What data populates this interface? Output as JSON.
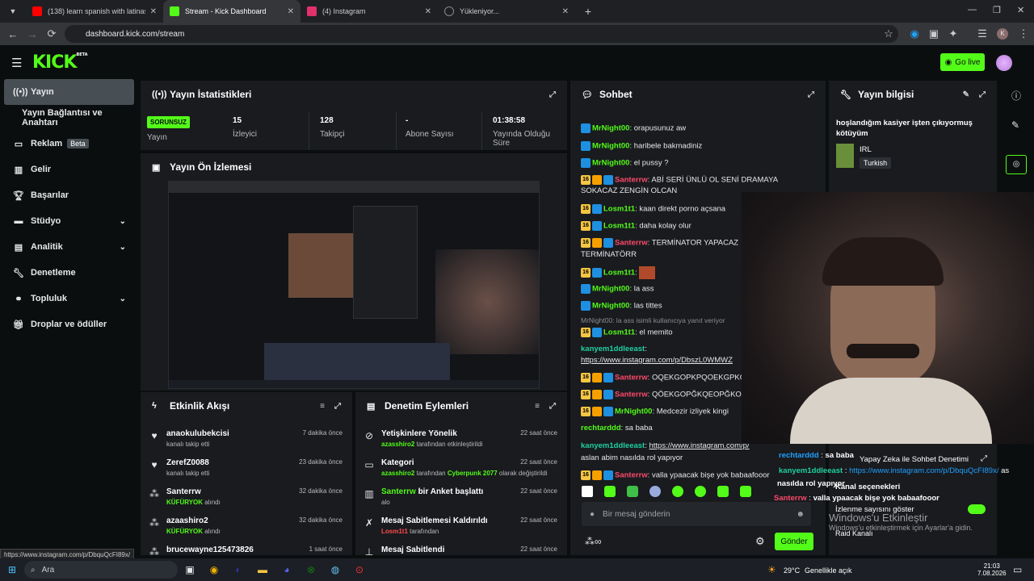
{
  "browser": {
    "tabs": [
      {
        "title": "(138) learn spanish with latinas",
        "color": "#ff0000"
      },
      {
        "title": "Stream - Kick Dashboard",
        "color": "#53fc18"
      },
      {
        "title": "(4) Instagram",
        "color": "#e1306c"
      },
      {
        "title": "Yükleniyor...",
        "color": "#555"
      }
    ],
    "url": "dashboard.kick.com/stream",
    "status_url": "https://www.instagram.com/p/DbquQcFI89x/"
  },
  "header": {
    "logo": "KICK",
    "logo_sup": "BETA",
    "go_live": "Go live"
  },
  "sidebar": {
    "items": [
      {
        "label": "Yayın",
        "icon": "broadcast-icon"
      },
      {
        "label": "Yayın Bağlantısı ve Anahtarı",
        "icon": ""
      },
      {
        "label": "Reklam",
        "icon": "ad-icon",
        "badge": "Beta"
      },
      {
        "label": "Gelir",
        "icon": "chart-icon"
      },
      {
        "label": "Başarılar",
        "icon": "trophy-icon"
      },
      {
        "label": "Stüdyo",
        "icon": "studio-icon"
      },
      {
        "label": "Analitik",
        "icon": "analytics-icon"
      },
      {
        "label": "Denetleme",
        "icon": "wrench-icon"
      },
      {
        "label": "Topluluk",
        "icon": "community-icon"
      },
      {
        "label": "Droplar ve ödüller",
        "icon": "gift-icon"
      }
    ]
  },
  "stats": {
    "title": "Yayın İstatistikleri",
    "status": "SORUNSUZ",
    "status_label": "Yayın",
    "viewers": "15",
    "viewers_label": "İzleyici",
    "followers": "128",
    "followers_label": "Takipçi",
    "subs": "-",
    "subs_label": "Abone Sayısı",
    "uptime": "01:38:58",
    "uptime_label": "Yayında Olduğu Süre"
  },
  "preview": {
    "title": "Yayın Ön İzlemesi"
  },
  "activity": {
    "title": "Etkinlik Akışı",
    "rows": [
      {
        "name": "anaokulubekcisi",
        "sub": "kanalı takip etti",
        "time": "7 dakika önce"
      },
      {
        "name": "ZerefZ0088",
        "sub": "kanalı takip etti",
        "time": "23 dakika önce"
      },
      {
        "name": "Santerrw",
        "sub_hl": "KÜFÜRYOK",
        "sub": "alındı",
        "time": "32 dakika önce"
      },
      {
        "name": "azaashiro2",
        "sub_hl": "KÜFÜRYOK",
        "sub": "alındı",
        "time": "32 dakika önce"
      },
      {
        "name": "brucewayne125473826",
        "sub": "",
        "time": "1 saat önce"
      }
    ]
  },
  "moderation": {
    "title": "Denetim Eylemleri",
    "rows": [
      {
        "name": "Yetişkinlere Yönelik",
        "user": "azasshiro2",
        "sub": "tarafından etkinleştirildi",
        "time": "22 saat önce"
      },
      {
        "name": "Kategori",
        "user": "azasshiro2",
        "sub": "tarafından",
        "extra": "Cyberpunk 2077",
        "sub2": "olarak değiştirildi",
        "time": "22 saat önce"
      },
      {
        "name": "bir Anket başlattı",
        "user_head": "Santerrw",
        "sub": "alo",
        "time": "22 saat önce"
      },
      {
        "name": "Mesaj Sabitlemesi Kaldırıldı",
        "user": "Losm1t1",
        "sub": "tarafından",
        "time": "22 saat önce"
      },
      {
        "name": "Mesaj Sabitlendi",
        "sub": "",
        "time": "22 saat önce"
      }
    ]
  },
  "chat": {
    "title": "Sohbet",
    "lines": [
      {
        "user": "MrNight00",
        "msg": "orapusunuz aw",
        "cls": "u-blue",
        "badges": [
          "sub"
        ]
      },
      {
        "user": "MrNight00",
        "msg": "haribele bakmadiniz",
        "cls": "u-blue",
        "badges": [
          "sub"
        ]
      },
      {
        "user": "MrNight00",
        "msg": "el pussy ?",
        "cls": "u-blue",
        "badges": [
          "sub"
        ]
      },
      {
        "user": "Santerrw",
        "msg": "ABİ SERİ ÜNLÜ OL SENİ DRAMAYA",
        "cls": "u-red",
        "badges": [
          "16",
          "crown",
          "sub"
        ]
      },
      {
        "user": "",
        "msg": "SOKACAZ ZENGİN OLCAN",
        "cls": "",
        "badges": []
      },
      {
        "user": "Losm1t1",
        "msg": "kaan direkt porno açsana",
        "cls": "u-blue",
        "badges": [
          "16",
          "sub"
        ]
      },
      {
        "user": "Losm1t1",
        "msg": "daha kolay olur",
        "cls": "u-blue",
        "badges": [
          "16",
          "sub"
        ]
      },
      {
        "user": "Santerrw",
        "msg": "TERMİNATOR YAPACAZ",
        "cls": "u-red",
        "badges": [
          "16",
          "crown",
          "sub"
        ]
      },
      {
        "user": "",
        "msg": "TERMİNATÖRR",
        "cls": "",
        "badges": []
      },
      {
        "user": "Losm1t1",
        "msg": "",
        "cls": "u-blue",
        "badges": [
          "16",
          "sub"
        ]
      },
      {
        "user": "MrNight00",
        "msg": "la ass",
        "cls": "u-blue",
        "badges": [
          "sub"
        ]
      },
      {
        "user": "MrNight00",
        "msg": "las tittes",
        "cls": "u-blue",
        "badges": [
          "sub"
        ]
      },
      {
        "user": "",
        "msg": "MrNight00: la ass isimli kullanıcıya yanıt veriyor",
        "cls": "",
        "badges": [],
        "reply": true
      },
      {
        "user": "Losm1t1",
        "msg": "el memito",
        "cls": "u-blue",
        "badges": [
          "16",
          "sub"
        ]
      },
      {
        "user": "kanyem1ddleeast",
        "msg": "",
        "cls": "u-teal",
        "badges": []
      },
      {
        "user": "",
        "msg": "https://www.instagram.com/p/DbszL0WMWZ",
        "cls": "",
        "badges": [],
        "link": true
      },
      {
        "user": "Santerrw",
        "msg": "OQEKGOPKPQOEKGPKO",
        "cls": "u-red",
        "badges": [
          "16",
          "crown",
          "sub"
        ]
      },
      {
        "user": "Santerrw",
        "msg": "QÖEKGOPĞKQEOPĞKO",
        "cls": "u-red",
        "badges": [
          "16",
          "crown",
          "sub"
        ]
      },
      {
        "user": "MrNight00",
        "msg": "Medcezir izliyek kingi",
        "cls": "u-blue",
        "badges": [
          "16",
          "crown",
          "sub"
        ]
      },
      {
        "user": "rechtarddd",
        "msg": "sa baba",
        "cls": "u-blue",
        "badges": []
      },
      {
        "user": "kanyem1ddleeast",
        "msg": "https://www.instagram.com/p/",
        "cls": "u-teal",
        "badges": [],
        "link": true
      },
      {
        "user": "",
        "msg": "aslan abim nasılda rol yapıyor",
        "cls": "",
        "badges": []
      },
      {
        "user": "Santerrw",
        "msg": "valla ypaacak bişe yok babaafooor",
        "cls": "u-red",
        "badges": [
          "16",
          "crown",
          "sub"
        ]
      }
    ],
    "input_placeholder": "Bir mesaj gönderin",
    "send": "Gönder"
  },
  "info": {
    "title": "Yayın bilgisi",
    "stream_title": "hoşlandığım kasiyer işten çıkıyormuş kötüyüm",
    "category": "IRL",
    "language": "Turkish"
  },
  "overlay": {
    "ai_label": "Yapay Zeka ile Sohbet Denetimi",
    "rech": "rechtarddd",
    "rech_msg": "sa baba",
    "kanye": "kanyem1ddleeast",
    "kanye_msg": "https://www.instagram.com/p/DbquQcFI89x/",
    "kanye_tail": "as",
    "rol": "nasılda rol yapıyor",
    "santerrw_tail": "valla ypaacak bişe yok babaafooor",
    "kanal": "Kanal seçenekleri",
    "izlenme": "İzlenme sayısını göster",
    "windows1": "Windows'u Etkinleştir",
    "windows2": "Windows'u etkinleştirmek için Ayarlar'a gidin.",
    "raid": "Raid Kanalı"
  },
  "taskbar": {
    "search": "Ara",
    "weather": "29°C",
    "weather_desc": "Genellikle açık",
    "time": "21:03",
    "date": "7.08.2026"
  }
}
